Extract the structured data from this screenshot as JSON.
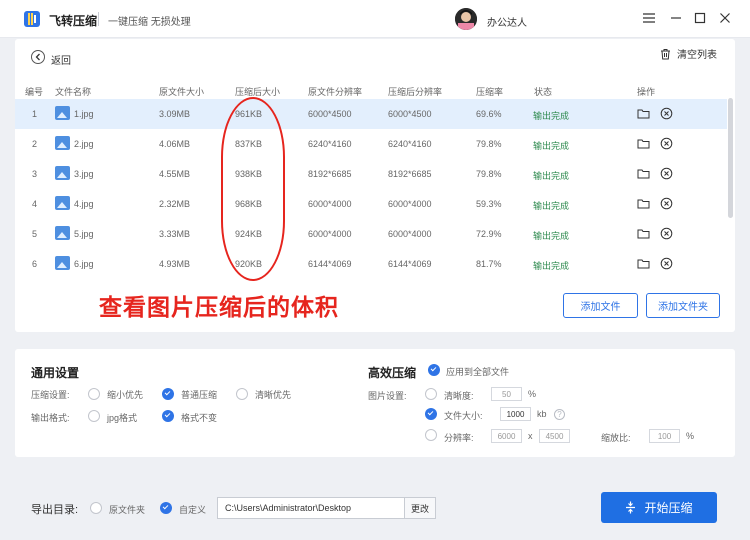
{
  "app": {
    "title": "飞转压缩",
    "slogan": "一键压缩 无损处理",
    "user": "办公达人"
  },
  "toolbar": {
    "back_label": "返回",
    "clear_label": "清空列表"
  },
  "table": {
    "headers": [
      "编号",
      "文件名称",
      "原文件大小",
      "压缩后大小",
      "原文件分辨率",
      "压缩后分辨率",
      "压缩率",
      "状态",
      "操作"
    ],
    "rows": [
      {
        "id": "1",
        "name": "1.jpg",
        "orig_size": "3.09MB",
        "new_size": "961KB",
        "orig_res": "6000*4500",
        "new_res": "6000*4500",
        "rate": "69.6%",
        "status": "输出完成"
      },
      {
        "id": "2",
        "name": "2.jpg",
        "orig_size": "4.06MB",
        "new_size": "837KB",
        "orig_res": "6240*4160",
        "new_res": "6240*4160",
        "rate": "79.8%",
        "status": "输出完成"
      },
      {
        "id": "3",
        "name": "3.jpg",
        "orig_size": "4.55MB",
        "new_size": "938KB",
        "orig_res": "8192*6685",
        "new_res": "8192*6685",
        "rate": "79.8%",
        "status": "输出完成"
      },
      {
        "id": "4",
        "name": "4.jpg",
        "orig_size": "2.32MB",
        "new_size": "968KB",
        "orig_res": "6000*4000",
        "new_res": "6000*4000",
        "rate": "59.3%",
        "status": "输出完成"
      },
      {
        "id": "5",
        "name": "5.jpg",
        "orig_size": "3.33MB",
        "new_size": "924KB",
        "orig_res": "6000*4000",
        "new_res": "6000*4000",
        "rate": "72.9%",
        "status": "输出完成"
      },
      {
        "id": "6",
        "name": "6.jpg",
        "orig_size": "4.93MB",
        "new_size": "920KB",
        "orig_res": "6144*4069",
        "new_res": "6144*4069",
        "rate": "81.7%",
        "status": "输出完成"
      }
    ]
  },
  "annotation": {
    "text": "查看图片压缩后的体积"
  },
  "buttons": {
    "add_file": "添加文件",
    "add_folder": "添加文件夹",
    "start": "开始压缩",
    "change": "更改"
  },
  "settings": {
    "general_title": "通用设置",
    "compress_label": "压缩设置:",
    "compress_options": [
      "缩小优先",
      "普通压缩",
      "清晰优先"
    ],
    "compress_selected": "普通压缩",
    "format_label": "输出格式:",
    "format_options": [
      "jpg格式",
      "格式不变"
    ],
    "format_selected": "格式不变",
    "efficient_title": "高效压缩",
    "apply_all": "应用到全部文件",
    "image_label": "图片设置:",
    "clarity_label": "清晰度:",
    "clarity_value": "50",
    "clarity_unit": "%",
    "filesize_label": "文件大小:",
    "filesize_value": "1000",
    "filesize_unit": "kb",
    "resolution_label": "分辨率:",
    "res_w": "6000",
    "res_x": "x",
    "res_h": "4500",
    "scale_label": "缩放比:",
    "scale_value": "100",
    "scale_unit": "%"
  },
  "export": {
    "label": "导出目录:",
    "options": [
      "原文件夹",
      "自定义"
    ],
    "selected": "自定义",
    "path": "C:\\Users\\Administrator\\Desktop"
  },
  "colors": {
    "accent": "#2f74e6",
    "annotation": "#e6251e",
    "status_ok": "#2d8a4e",
    "selected_row": "#e3effd"
  }
}
